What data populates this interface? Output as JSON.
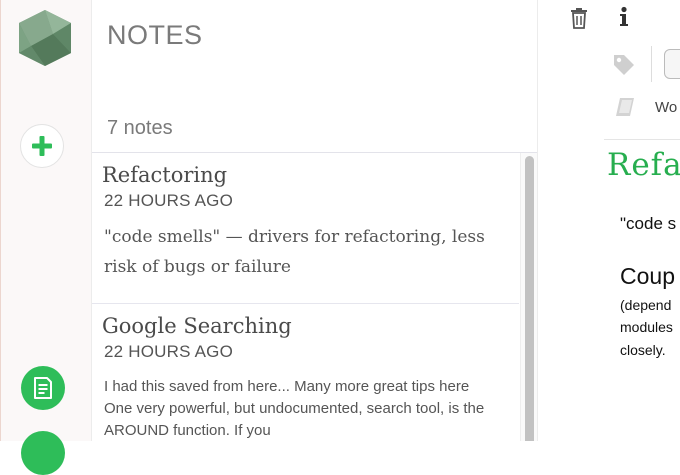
{
  "sidebar": {
    "logo_icon": "hexagon-gem-logo",
    "new_note_icon": "plus-icon",
    "notes_icon": "note-document-icon",
    "accent_color": "#2ebd59"
  },
  "list": {
    "title": "NOTES",
    "count": "7 notes",
    "items": [
      {
        "title": "Refactoring",
        "time": "22 HOURS AGO",
        "snippet": "\"code smells\" — drivers for refactoring, less risk of bugs or failure"
      },
      {
        "title": "Google Searching",
        "time": "22 HOURS AGO",
        "snippet": "I had this saved from here... Many more great tips here One very powerful, but undocumented, search tool, is the AROUND function. If you"
      }
    ]
  },
  "editor": {
    "toolbar_icons": [
      "trash-icon",
      "info-icon",
      "tag-icon",
      "notebook-icon"
    ],
    "notebook": "Wo",
    "heading": "Refa",
    "body": {
      "line1": "\"code s",
      "subheading": "Coup",
      "line2": "(depend",
      "line3": "modules",
      "line4": "closely."
    },
    "accent_color": "#27ae4f"
  }
}
